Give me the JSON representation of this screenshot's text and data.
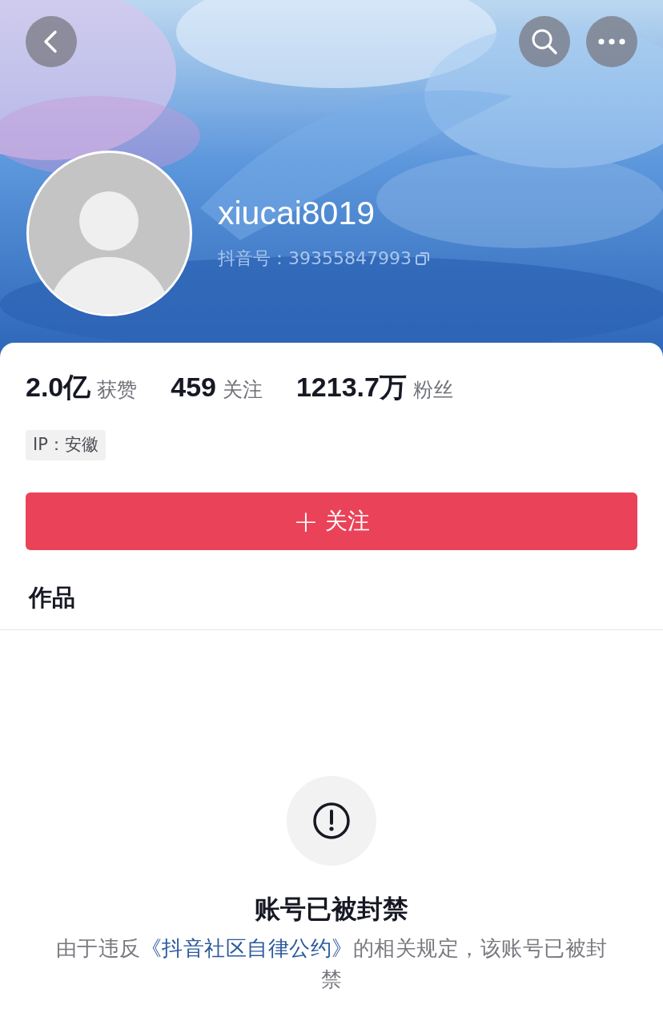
{
  "profile": {
    "name": "xiucai8019",
    "id_label": "抖音号：",
    "id_value": "39355847993"
  },
  "stats": [
    "**2.0亿** 获赞",
    "**459** 关注",
    "**1213.7万** 粉丝"
  ],
  "ip_tag": "IP：安徽",
  "follow_button": {
    "icon": "+",
    "label": "关注"
  },
  "tabs": [
    {
      "label": "作品",
      "selected": true
    }
  ],
  "notice": {
    "title": "账号已被封禁",
    "text_before": "由于违反",
    "link": "《抖音社区自律公约》",
    "text_after": "的相关规定，该账号已被封禁"
  }
}
